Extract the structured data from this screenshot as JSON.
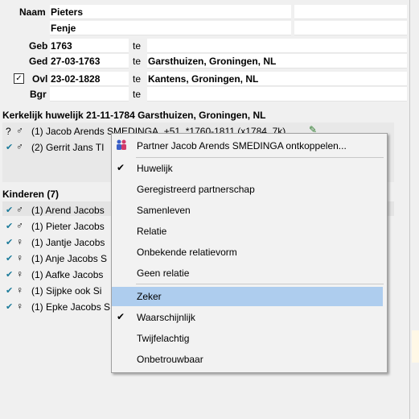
{
  "person": {
    "naam_label": "Naam",
    "surname": "Pieters",
    "firstname": "Fenje",
    "geb_label": "Geb",
    "geb_date": "1763",
    "ged_label": "Ged",
    "ged_date": "27-03-1763",
    "ged_place": "Garsthuizen, Groningen, NL",
    "ovl_label": "Ovl",
    "ovl_date": "23-02-1828",
    "ovl_place": "Kantens, Groningen, NL",
    "bgr_label": "Bgr",
    "te": "te"
  },
  "marriage": {
    "title": "Kerkelijk huwelijk 21-11-1784 Garsthuizen, Groningen, NL",
    "partners": [
      {
        "status": "?",
        "text": "(1) Jacob Arends SMEDINGA, +51, *1760-1811 (x1784, 7k)"
      },
      {
        "status": "✔",
        "text": "(2) Gerrit Jans TI"
      }
    ]
  },
  "children": {
    "title": "Kinderen (7)",
    "items": [
      {
        "gender": "♂",
        "text": "(1) Arend Jacobs"
      },
      {
        "gender": "♂",
        "text": "(1) Pieter Jacobs"
      },
      {
        "gender": "♀",
        "text": "(1) Jantje Jacobs"
      },
      {
        "gender": "♀",
        "text": "(1) Anje Jacobs S"
      },
      {
        "gender": "♀",
        "text": "(1) Aafke Jacobs"
      },
      {
        "gender": "♀",
        "text": "(1) Sijpke ook Si"
      },
      {
        "gender": "♀",
        "text": "(1) Epke Jacobs S"
      }
    ]
  },
  "context_menu": {
    "unlink": "Partner Jacob Arends SMEDINGA ontkoppelen...",
    "relation_types": [
      {
        "label": "Huwelijk",
        "checked": true
      },
      {
        "label": "Geregistreerd partnerschap",
        "checked": false
      },
      {
        "label": "Samenleven",
        "checked": false
      },
      {
        "label": "Relatie",
        "checked": false
      },
      {
        "label": "Onbekende relatievorm",
        "checked": false
      },
      {
        "label": "Geen relatie",
        "checked": false
      }
    ],
    "certainty": [
      {
        "label": "Zeker",
        "checked": false,
        "highlighted": true
      },
      {
        "label": "Waarschijnlijk",
        "checked": true
      },
      {
        "label": "Twijfelachtig",
        "checked": false
      },
      {
        "label": "Onbetrouwbaar",
        "checked": false
      }
    ]
  }
}
